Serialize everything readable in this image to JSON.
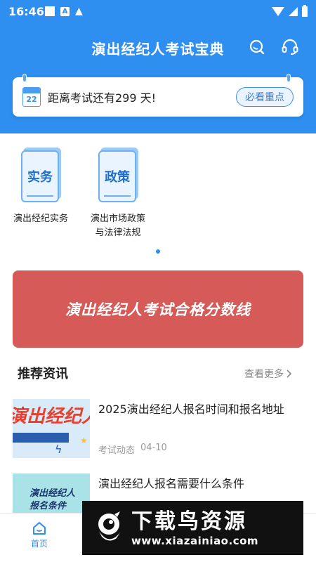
{
  "status": {
    "time": "16:46",
    "a_badge": "A"
  },
  "header": {
    "title": "演出经纪人考试宝典",
    "search_icon": "search-icon",
    "support_icon": "headset-icon",
    "background": "#2f8ff0"
  },
  "countdown": {
    "calendar_day": "22",
    "text": "距离考试还有299 天!",
    "button_label": "必看重点"
  },
  "categories": [
    {
      "icon_label": "实务",
      "label": "演出经纪实务"
    },
    {
      "icon_label": "政策",
      "label": "演出市场政策\n与法律法规"
    }
  ],
  "banner": {
    "text": "演出经纪人考试合格分数线",
    "color": "#d65a58"
  },
  "news_section": {
    "title": "推荐资讯",
    "more_label": "查看更多",
    "items": [
      {
        "thumb_text": "演出经纪人",
        "title": "2025演出经纪人报名时间和报名地址",
        "category": "考试动态",
        "date": "04-10"
      },
      {
        "thumb_text": "演出经纪人\n报名条件",
        "title": "演出经纪人报名需要什么条件"
      }
    ]
  },
  "bottom_nav": {
    "home_label": "首页"
  },
  "watermark": {
    "title": "下载鸟资源",
    "url": "www.xiazainiao.com"
  }
}
